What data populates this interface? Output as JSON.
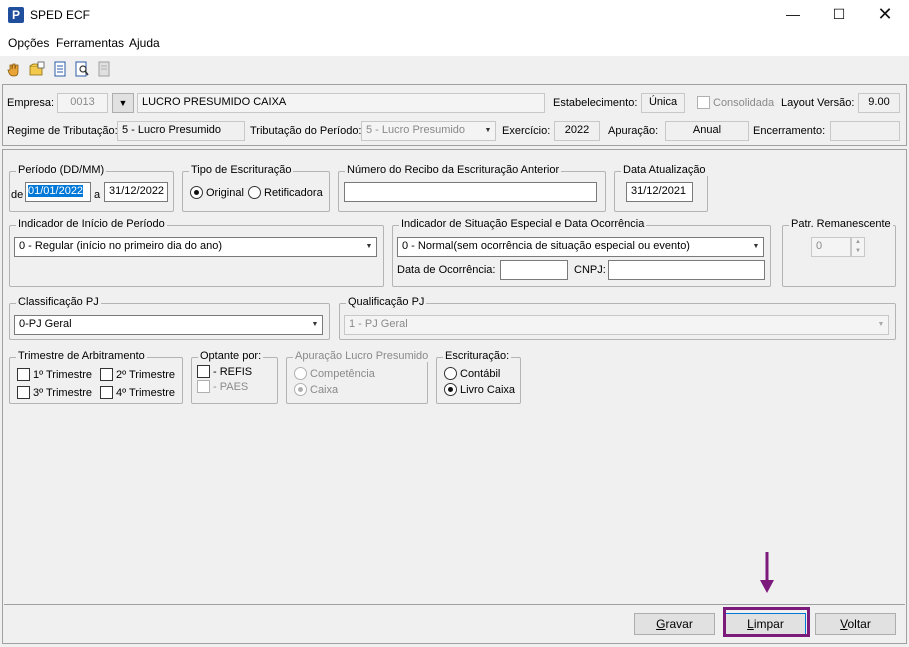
{
  "window": {
    "title": "SPED ECF",
    "app_icon": "P"
  },
  "menu": [
    "Opções",
    "Ferramentas",
    "Ajuda"
  ],
  "toolbar_icons": [
    "hand-icon",
    "open-folder-icon",
    "document-icon",
    "search-document-icon",
    "page-icon"
  ],
  "header": {
    "empresa_label": "Empresa:",
    "empresa_code": "0013",
    "empresa_name": "LUCRO PRESUMIDO CAIXA",
    "estabelecimento_label": "Estabelecimento:",
    "estabelecimento_value": "Única",
    "consolidada_label": "Consolidada",
    "layout_label": "Layout Versão:",
    "layout_value": "9.00",
    "regime_label": "Regime de Tributação:",
    "regime_value": "5 - Lucro Presumido",
    "tributacao_label": "Tributação do Período:",
    "tributacao_value": "5 - Lucro Presumido",
    "exercicio_label": "Exercício:",
    "exercicio_value": "2022",
    "apuracao_label": "Apuração:",
    "apuracao_value": "Anual",
    "encerramento_label": "Encerramento:",
    "encerramento_value": ""
  },
  "periodo": {
    "title": "Período (DD/MM)",
    "de_label": "de",
    "start": "01/01/2022",
    "a_label": "a",
    "end": "31/12/2022"
  },
  "tipo": {
    "title": "Tipo de Escrituração",
    "original": "Original",
    "retificadora": "Retificadora"
  },
  "recibo": {
    "title": "Número do Recibo da Escrituração Anterior",
    "value": ""
  },
  "data_atualizacao": {
    "title": "Data Atualização",
    "value": "31/12/2021"
  },
  "inicio": {
    "title": "Indicador de Início de Período",
    "value": "0 - Regular (início no primeiro dia do ano)"
  },
  "situacao": {
    "title": "Indicador de Situação Especial e Data Ocorrência",
    "value": "0 - Normal(sem ocorrência de situação especial ou evento)",
    "data_label": "Data de Ocorrência:",
    "data_value": "",
    "cnpj_label": "CNPJ:",
    "cnpj_value": ""
  },
  "patr": {
    "title": "Patr. Remanescente",
    "value": "0"
  },
  "classificacao": {
    "title": "Classificação PJ",
    "value": "0-PJ Geral"
  },
  "qualificacao": {
    "title": "Qualificação PJ",
    "value": "1 - PJ Geral"
  },
  "trimestre": {
    "title": "Trimestre de Arbitramento",
    "t1": "1º Trimestre",
    "t2": "2º Trimestre",
    "t3": "3º Trimestre",
    "t4": "4º Trimestre"
  },
  "optante": {
    "title": "Optante por:",
    "refis": "- REFIS",
    "paes": "- PAES"
  },
  "apuracao_lp": {
    "title": "Apuração Lucro Presumido",
    "competencia": "Competência",
    "caixa": "Caixa"
  },
  "escrituracao": {
    "title": "Escrituração:",
    "contabil": "Contábil",
    "livro_caixa": "Livro Caixa"
  },
  "buttons": {
    "gravar_mn": "G",
    "gravar_rest": "ravar",
    "limpar_mn": "L",
    "limpar_rest": "impar",
    "voltar_mn": "V",
    "voltar_rest": "oltar"
  },
  "colors": {
    "annotation": "#7b1a7b",
    "selection": "#0078d7"
  }
}
